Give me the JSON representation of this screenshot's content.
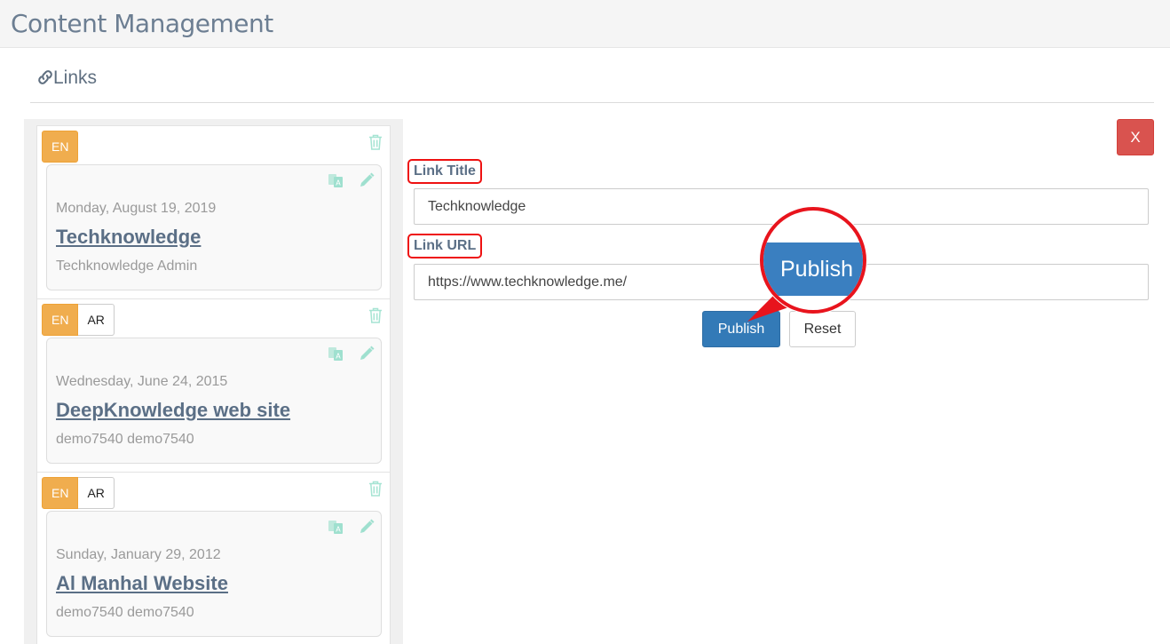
{
  "header": {
    "title": "Content Management"
  },
  "section": {
    "label": "Links",
    "icon": "link-icon"
  },
  "links": [
    {
      "languages": [
        "EN"
      ],
      "active_language": "EN",
      "date": "Monday, August 19, 2019",
      "title": "Techknowledge",
      "author": "Techknowledge Admin"
    },
    {
      "languages": [
        "EN",
        "AR"
      ],
      "active_language": "EN",
      "date": "Wednesday, June 24, 2015",
      "title": "DeepKnowledge web site",
      "author": "demo7540 demo7540"
    },
    {
      "languages": [
        "EN",
        "AR"
      ],
      "active_language": "EN",
      "date": "Sunday, January 29, 2012",
      "title": "Al Manhal Website",
      "author": "demo7540 demo7540"
    }
  ],
  "form": {
    "close_label": "X",
    "title_label": "Link Title",
    "title_value": "Techknowledge",
    "url_label": "Link URL",
    "url_value": "https://www.techknowledge.me/",
    "publish_label": "Publish",
    "reset_label": "Reset"
  },
  "callout": {
    "zoom_text": "Publish"
  },
  "colors": {
    "accent_orange": "#f0ad4e",
    "primary_blue": "#337ab7",
    "danger_red": "#d9534f",
    "highlight_red": "#e8141d",
    "icon_teal": "#9fe0cf"
  }
}
